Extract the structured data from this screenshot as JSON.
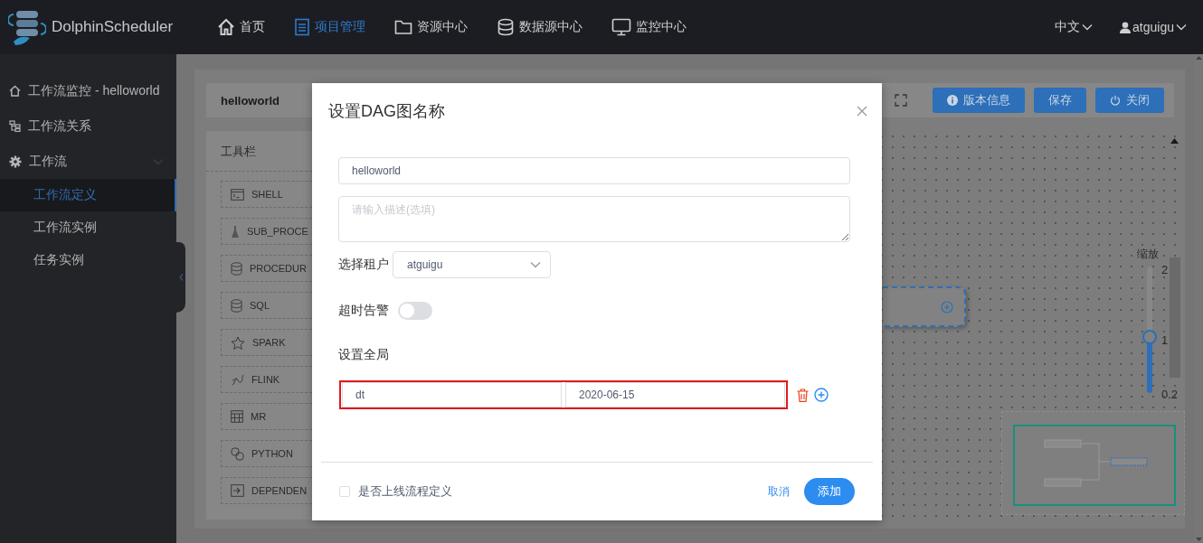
{
  "brand": "DolphinScheduler",
  "nav": [
    {
      "label": "首页",
      "kind": "home",
      "selected": false
    },
    {
      "label": "项目管理",
      "kind": "document",
      "selected": true
    },
    {
      "label": "资源中心",
      "kind": "folder",
      "selected": false
    },
    {
      "label": "数据源中心",
      "kind": "database",
      "selected": false
    },
    {
      "label": "监控中心",
      "kind": "monitor",
      "selected": false
    }
  ],
  "language": "中文",
  "user": "atguigu",
  "sidebar": {
    "items": [
      {
        "label": "工作流监控 - helloworld",
        "kind": "home"
      },
      {
        "label": "工作流关系",
        "kind": "tree"
      },
      {
        "label": "工作流",
        "kind": "gear",
        "expanded": true,
        "children": [
          {
            "label": "工作流定义",
            "selected": true
          },
          {
            "label": "工作流实例",
            "selected": false
          },
          {
            "label": "任务实例",
            "selected": false
          }
        ]
      }
    ]
  },
  "editor": {
    "title": "helloworld",
    "buttons": [
      {
        "label": "版本信息",
        "kind": "info"
      },
      {
        "label": "保存",
        "kind": "plain"
      },
      {
        "label": "关闭",
        "kind": "power"
      }
    ],
    "toolbar_title": "工具栏",
    "tools": [
      {
        "label": "SHELL",
        "kind": "terminal"
      },
      {
        "label": "SUB_PROCE",
        "kind": "flask"
      },
      {
        "label": "PROCEDUR",
        "kind": "database"
      },
      {
        "label": "SQL",
        "kind": "database"
      },
      {
        "label": "SPARK",
        "kind": "star"
      },
      {
        "label": "FLINK",
        "kind": "squiggle"
      },
      {
        "label": "MR",
        "kind": "grid"
      },
      {
        "label": "PYTHON",
        "kind": "link"
      },
      {
        "label": "DEPENDEN",
        "kind": "import"
      }
    ],
    "zoom": {
      "label": "缩放",
      "ticks": [
        "2",
        "1",
        "0.2"
      ],
      "level": 0.44
    }
  },
  "dialog": {
    "title": "设置DAG图名称",
    "name": "helloworld",
    "description_placeholder": "请输入描述(选填)",
    "tenant_label": "选择租户",
    "tenant": "atguigu",
    "timeout_label": "超时告警",
    "timeout_on": false,
    "global_label": "设置全局",
    "params": [
      {
        "key": "dt",
        "value": "2020-06-15",
        "highlighted": true
      }
    ],
    "publish_label": "是否上线流程定义",
    "publish_checked": false,
    "cancel": "取消",
    "confirm": "添加"
  }
}
